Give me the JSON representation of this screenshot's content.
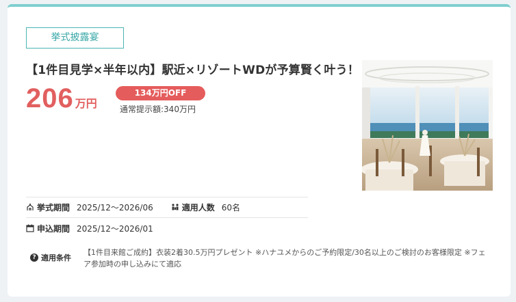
{
  "plan": {
    "category": "挙式披露宴",
    "title": "【1件目見学×半年以内】駅近×リゾートWDが予算賢く叶う！",
    "price_number": "206",
    "price_unit": "万円",
    "discount_badge": "134万円OFF",
    "regular_price": "通常提示額:340万円"
  },
  "details": {
    "ceremony_period_label": "挙式期間",
    "ceremony_period_value": "2025/12〜2026/06",
    "guests_label": "適用人数",
    "guests_value": "60名",
    "application_period_label": "申込期間",
    "application_period_value": "2025/12〜2026/01",
    "conditions_label": "適用条件",
    "conditions_text": "【1件目来館ご成約】衣装2着30.5万円プレゼント ※ハナユメからのご予約限定/30名以上のご検討のお客様限定 ※フェア参加時の申し込みにて適応"
  },
  "icons": {
    "ceremony": "chapel-icon",
    "guests": "people-icon",
    "calendar": "calendar-icon",
    "conditions": "question-circle-icon"
  },
  "colors": {
    "accent_teal": "#4bb3b3",
    "price_red": "#e25f5f",
    "badge_red": "#e55c5c",
    "top_border": "#7fcfcf"
  }
}
